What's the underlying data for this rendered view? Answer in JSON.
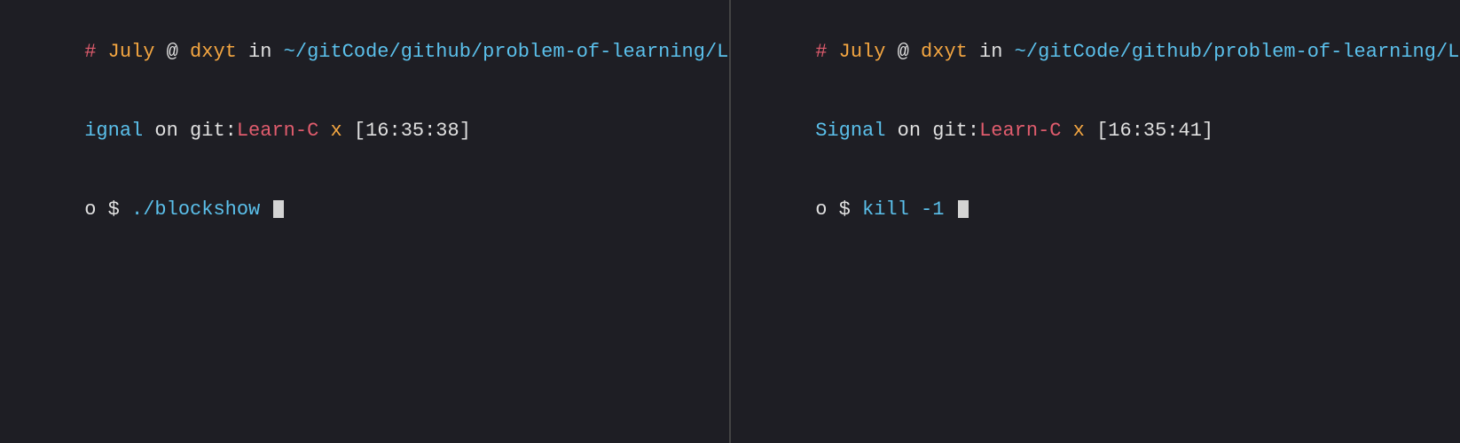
{
  "panes": [
    {
      "id": "pane-left",
      "prompt_line1": {
        "hash": "# ",
        "month": "July",
        "at_sign": " @ ",
        "hostname": "dxyt",
        "in_text": " in ",
        "path": "~/gitCode/github/problem-of-learning/Linux/Code/CPP/procS",
        "path2": "ignal",
        "on_text": " on ",
        "git_label": "git:",
        "branch": "Learn-C",
        "x_label": " x ",
        "timestamp": "[16:35:38]"
      },
      "command_line": {
        "circle": "o",
        "dollar": " $ ",
        "command": "./blockshow",
        "cursor": true
      }
    },
    {
      "id": "pane-right",
      "prompt_line1": {
        "hash": "# ",
        "month": "July",
        "at_sign": " @ ",
        "hostname": "dxyt",
        "in_text": " in ",
        "path": "~/gitCode/github/problem-of-learning/Linux/Code/CPP/proc",
        "path2": "Signal",
        "on_text": " on ",
        "git_label": "git:",
        "branch": "Learn-C",
        "x_label": " x ",
        "timestamp": "[16:35:41]"
      },
      "command_line": {
        "circle": "o",
        "dollar": " $ ",
        "command": "kill -1",
        "cursor": true
      }
    }
  ]
}
